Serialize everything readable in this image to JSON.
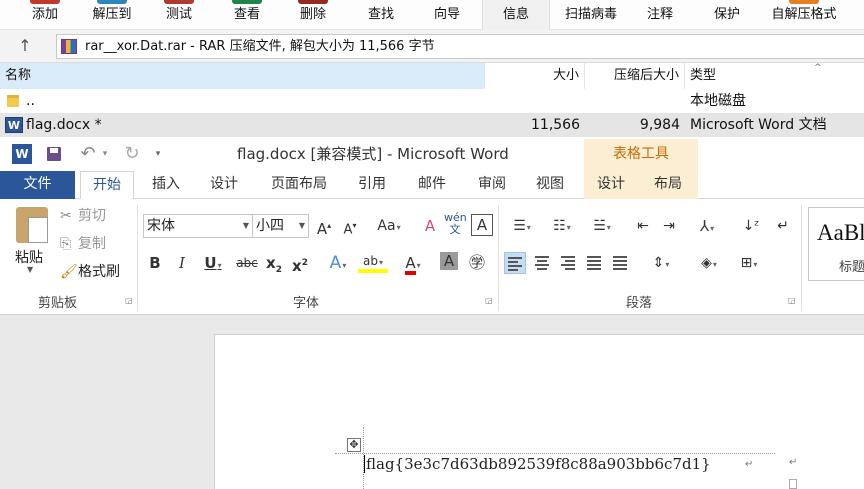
{
  "rar": {
    "toolbar": [
      {
        "label": "添加"
      },
      {
        "label": "解压到"
      },
      {
        "label": "测试"
      },
      {
        "label": "查看"
      },
      {
        "label": "删除"
      },
      {
        "label": "查找"
      },
      {
        "label": "向导"
      },
      {
        "label": "信息"
      },
      {
        "label": "扫描病毒"
      },
      {
        "label": "注释"
      },
      {
        "label": "保护"
      },
      {
        "label": "自解压格式"
      }
    ],
    "up_icon": "↑",
    "path_text": "rar__xor.Dat.rar - RAR 压缩文件, 解包大小为 11,566 字节",
    "columns": {
      "name": "名称",
      "size": "大小",
      "packed": "压缩后大小",
      "type": "类型"
    },
    "rows": [
      {
        "name": "..",
        "size": "",
        "packed": "",
        "type": "本地磁盘"
      },
      {
        "name": "flag.docx *",
        "size": "11,566",
        "packed": "9,984",
        "type": "Microsoft Word 文档"
      }
    ],
    "colors": {
      "selected_header": "#d9ebf9",
      "selected_row": "#e5e5e5"
    }
  },
  "word": {
    "app_icon": "W",
    "title": "flag.docx [兼容模式] - Microsoft Word",
    "context_tools": "表格工具",
    "tabs": [
      {
        "label": "文件"
      },
      {
        "label": "开始"
      },
      {
        "label": "插入"
      },
      {
        "label": "设计"
      },
      {
        "label": "页面布局"
      },
      {
        "label": "引用"
      },
      {
        "label": "邮件"
      },
      {
        "label": "审阅"
      },
      {
        "label": "视图"
      },
      {
        "label": "设计"
      },
      {
        "label": "布局"
      }
    ],
    "ribbon": {
      "clipboard": {
        "paste": "粘贴",
        "cut": "剪切",
        "copy": "复制",
        "format_painter": "格式刷",
        "group": "剪贴板"
      },
      "font": {
        "name": "宋体",
        "size": "小四",
        "group": "字体"
      },
      "paragraph": {
        "group": "段落"
      },
      "styles": {
        "preview": "AaBl",
        "name": "标题"
      }
    },
    "document": {
      "text": "flag{3e3c7d63db892539f8c88a903bb6c7d1}"
    },
    "colors": {
      "accent": "#2b579a",
      "context_bg": "#fbeed3",
      "context_text": "#c46d06"
    }
  }
}
